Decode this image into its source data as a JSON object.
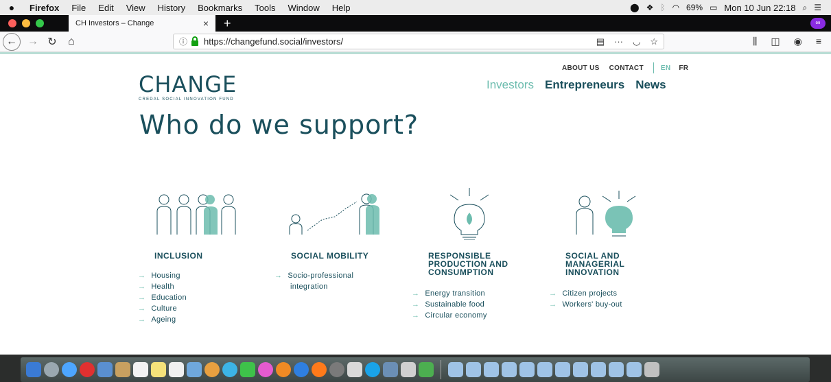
{
  "menubar": {
    "app": "Firefox",
    "items": [
      "File",
      "Edit",
      "View",
      "History",
      "Bookmarks",
      "Tools",
      "Window",
      "Help"
    ],
    "battery": "69%",
    "clock": "Mon 10 Jun  22:18"
  },
  "tab": {
    "title": "CH  Investors – Change",
    "close": "×"
  },
  "newtab": "+",
  "address": {
    "url": "https://changefund.social/investors/"
  },
  "page": {
    "topnav": {
      "about": "ABOUT US",
      "contact": "CONTACT",
      "en": "EN",
      "fr": "FR"
    },
    "logo": {
      "word": "CHANGE",
      "tagline": "CREDAL SOCIAL INNOVATION FUND"
    },
    "mainnav": {
      "investors": "Investors",
      "entrepreneurs": "Entrepreneurs",
      "news": "News"
    },
    "headline": "Who do we support?",
    "columns": [
      {
        "title": [
          "INCLUSION"
        ],
        "items": [
          "Housing",
          "Health",
          "Education",
          "Culture",
          "Ageing"
        ]
      },
      {
        "title": [
          "SOCIAL MOBILITY"
        ],
        "items": [
          "Socio-professional",
          "integration"
        ]
      },
      {
        "title": [
          "RESPONSIBLE",
          "PRODUCTION AND",
          "CONSUMPTION"
        ],
        "items": [
          "Energy transition",
          "Sustainable food",
          "Circular economy"
        ]
      },
      {
        "title": [
          "SOCIAL AND",
          "MANAGERIAL",
          "INNOVATION"
        ],
        "items": [
          "Citizen projects",
          "Workers' buy-out"
        ]
      }
    ],
    "arrow": "→"
  },
  "colors": {
    "brand": "#1a4f5c",
    "accent": "#6cbcae"
  }
}
